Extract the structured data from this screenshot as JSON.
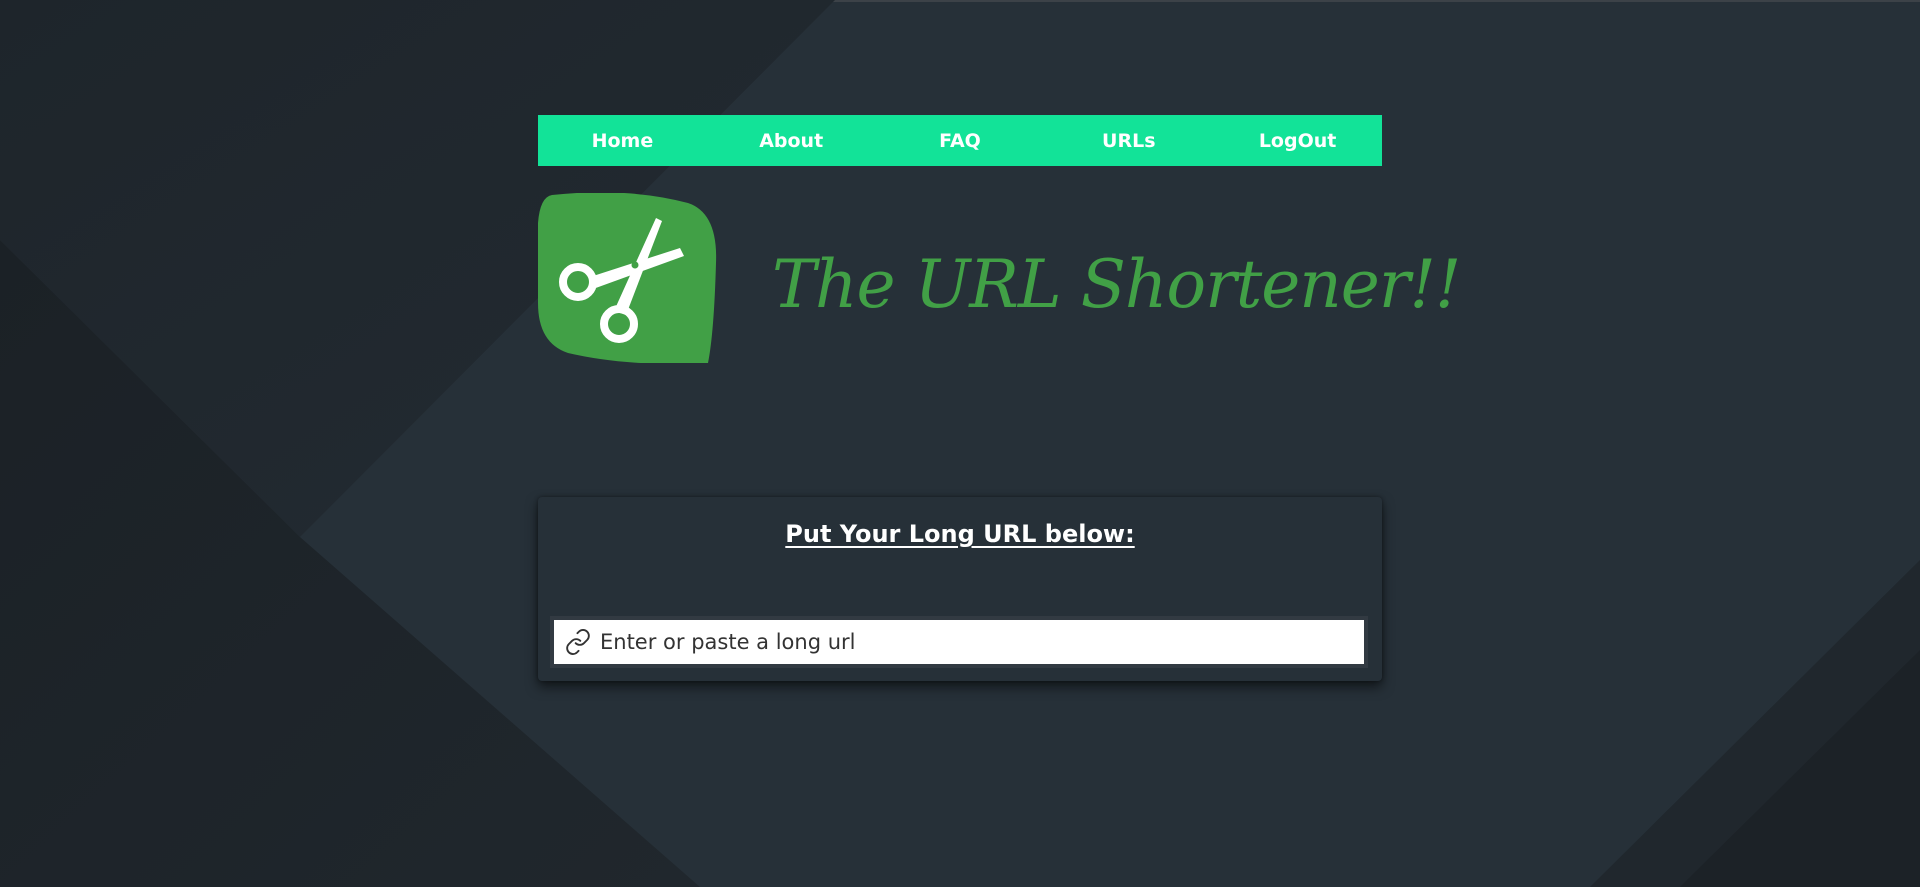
{
  "nav": {
    "items": [
      {
        "label": "Home"
      },
      {
        "label": "About"
      },
      {
        "label": "FAQ"
      },
      {
        "label": "URLs"
      },
      {
        "label": "LogOut"
      }
    ]
  },
  "header": {
    "logo_icon": "scissors-icon",
    "title": "The URL Shortener!!"
  },
  "shorten_form": {
    "heading": "Put Your Long URL below:",
    "input_icon": "link-icon",
    "input_value": "",
    "input_placeholder": "Enter or paste a long url"
  },
  "colors": {
    "background": "#263038",
    "nav_bar": "#12e398",
    "brand_green": "#41a046",
    "nav_text": "#ffffff"
  }
}
